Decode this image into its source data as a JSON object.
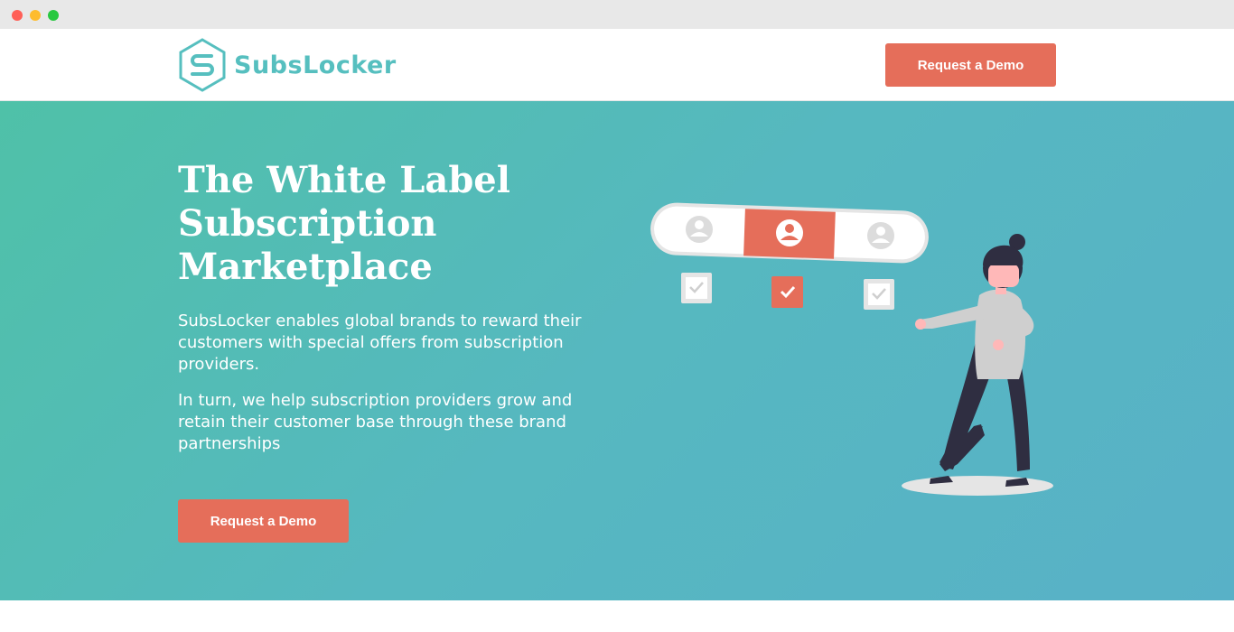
{
  "brand": {
    "name": "SubsLocker",
    "accent_color": "#56bfbf",
    "cta_color": "#e56e5a"
  },
  "header": {
    "cta_label": "Request a Demo"
  },
  "hero": {
    "title": "The White Label Subscription Marketplace",
    "paragraph_1": "SubsLocker enables global brands to reward their customers with special offers from subscription providers.",
    "paragraph_2": "In turn, we help subscription providers grow and retain their customer base through these brand partnerships",
    "cta_label": "Request a Demo",
    "background_colors": [
      "#4fc1a8",
      "#58b1c7"
    ]
  },
  "illustration": {
    "icons": [
      "user-icon",
      "user-icon",
      "user-icon",
      "checkbox-icon",
      "checkbox-icon",
      "checkbox-icon"
    ],
    "selected_option": 2
  }
}
